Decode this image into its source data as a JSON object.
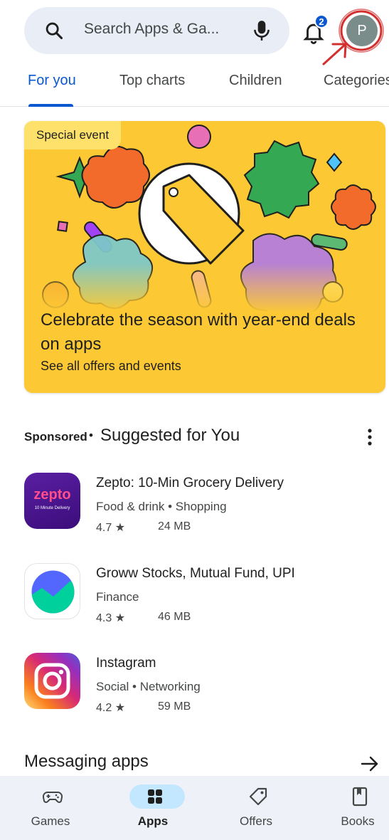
{
  "search": {
    "placeholder": "Search Apps & Ga..."
  },
  "notifications": {
    "count": "2"
  },
  "profile": {
    "initial": "P"
  },
  "tabs": [
    {
      "label": "For you",
      "active": true
    },
    {
      "label": "Top charts"
    },
    {
      "label": "Children"
    },
    {
      "label": "Categories"
    }
  ],
  "banner": {
    "tag": "Special event",
    "title": "Celebrate the season with year-end deals on apps",
    "subtitle": "See all offers and events"
  },
  "suggested": {
    "sponsored": "Sponsored",
    "separator": "•",
    "title": "Suggested for You",
    "apps": [
      {
        "name": "Zepto: 10-Min Grocery Delivery",
        "category": "Food & drink • Shopping",
        "rating": "4.7 ★",
        "size": "24 MB",
        "icon": "zepto-icon",
        "icon_text": "zepto",
        "icon_subtext": "10 Minute Delivery"
      },
      {
        "name": "Groww Stocks, Mutual Fund, UPI",
        "category": "Finance",
        "rating": "4.3 ★",
        "size": "46 MB",
        "icon": "groww-icon"
      },
      {
        "name": "Instagram",
        "category": "Social • Networking",
        "rating": "4.2 ★",
        "size": "59 MB",
        "icon": "instagram-icon"
      }
    ]
  },
  "messaging": {
    "title": "Messaging apps"
  },
  "bottom_nav": [
    {
      "label": "Games",
      "icon": "gamepad-icon"
    },
    {
      "label": "Apps",
      "icon": "apps-grid-icon",
      "active": true
    },
    {
      "label": "Offers",
      "icon": "tag-icon"
    },
    {
      "label": "Books",
      "icon": "book-icon"
    }
  ],
  "colors": {
    "accent": "#0b57d0",
    "banner": "#fcc934",
    "annotation": "#d32f2f"
  }
}
